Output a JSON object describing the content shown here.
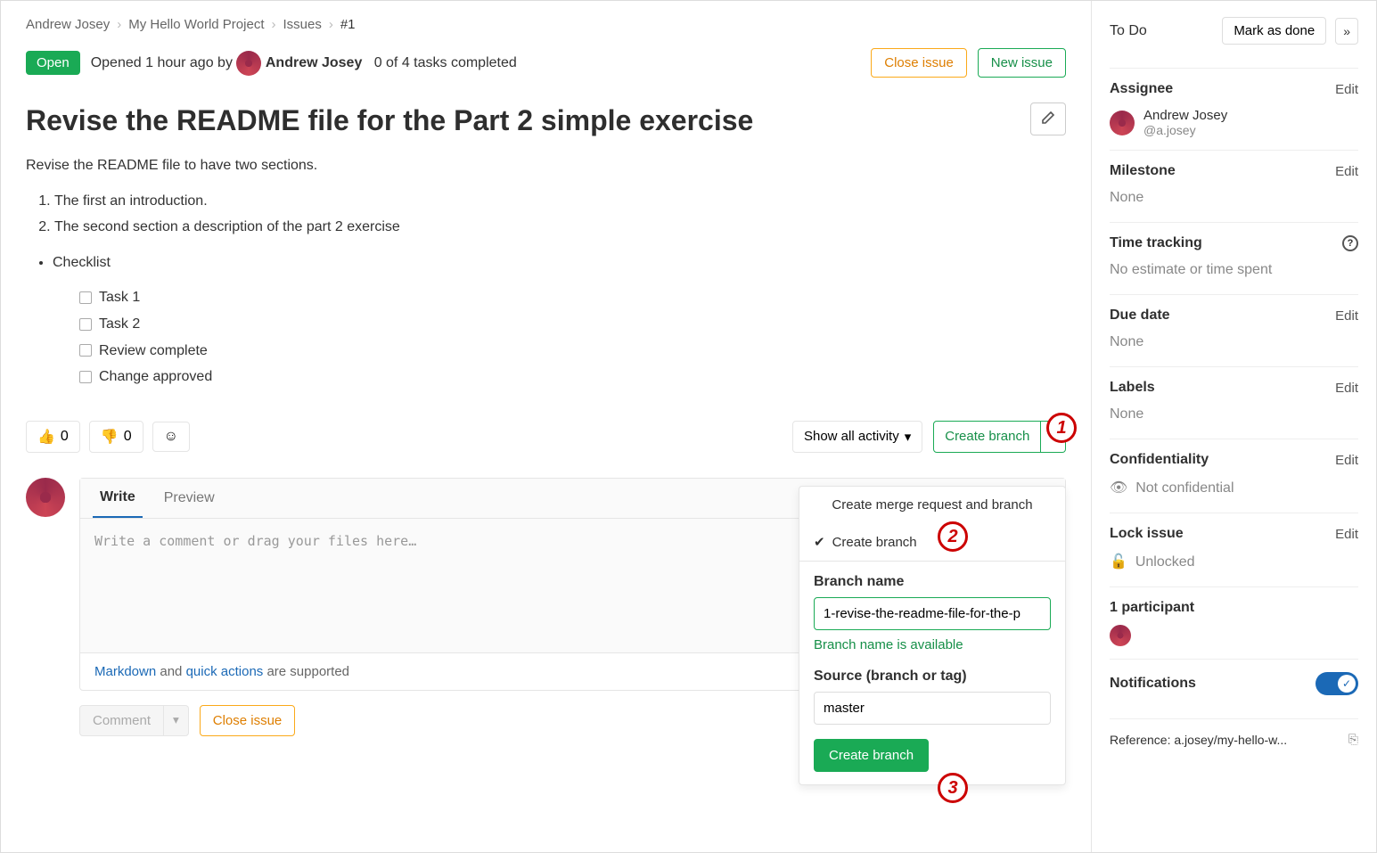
{
  "breadcrumb": {
    "owner": "Andrew Josey",
    "project": "My Hello World Project",
    "section": "Issues",
    "id": "#1"
  },
  "status": {
    "badge": "Open",
    "opened_prefix": "Opened ",
    "time": "1 hour ago",
    "by": " by ",
    "author": "Andrew Josey",
    "tasks": "0 of 4 tasks completed"
  },
  "buttons": {
    "close_issue": "Close issue",
    "new_issue": "New issue",
    "create_branch": "Create branch",
    "show_activity": "Show all activity",
    "comment": "Comment",
    "close_issue2": "Close issue",
    "mark_done": "Mark as done"
  },
  "issue": {
    "title": "Revise the README file for the Part 2 simple exercise",
    "description": "Revise the README file to have two sections.",
    "ol": [
      "The first an introduction.",
      "The second section a description of the part 2 exercise"
    ],
    "checklist_title": "Checklist",
    "checklist": [
      "Task 1",
      "Task 2",
      "Review complete",
      "Change approved"
    ]
  },
  "reactions": {
    "thumbs_up": "0",
    "thumbs_down": "0"
  },
  "editor": {
    "tab_write": "Write",
    "tab_preview": "Preview",
    "placeholder": "Write a comment or drag your files here…",
    "md_link": "Markdown",
    "and": " and ",
    "qa_link": "quick actions",
    "supported": " are supported"
  },
  "dropdown": {
    "create_mr": "Create merge request and branch",
    "create_branch": "Create branch",
    "branch_label": "Branch name",
    "branch_value": "1-revise-the-readme-file-for-the-p",
    "available": "Branch name is available",
    "source_label": "Source (branch or tag)",
    "source_value": "master",
    "submit": "Create branch"
  },
  "sidebar": {
    "todo": "To Do",
    "assignee_label": "Assignee",
    "assignee_name": "Andrew Josey",
    "assignee_handle": "@a.josey",
    "milestone_label": "Milestone",
    "none": "None",
    "time_label": "Time tracking",
    "time_val": "No estimate or time spent",
    "due_label": "Due date",
    "labels_label": "Labels",
    "conf_label": "Confidentiality",
    "conf_val": "Not confidential",
    "lock_label": "Lock issue",
    "lock_val": "Unlocked",
    "participants": "1 participant",
    "notifications": "Notifications",
    "reference": "Reference: a.josey/my-hello-w...",
    "edit": "Edit"
  },
  "annotations": {
    "a1": "1",
    "a2": "2",
    "a3": "3"
  }
}
